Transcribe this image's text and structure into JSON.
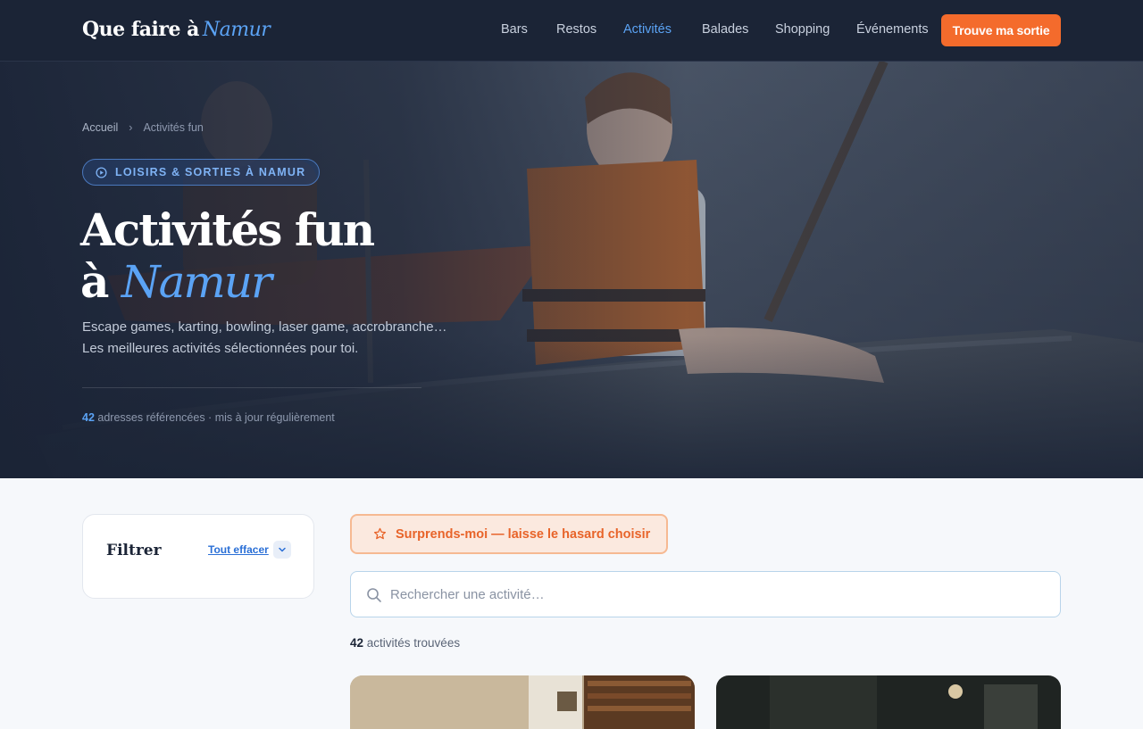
{
  "site": {
    "logo_main": "Que faire à",
    "logo_accent": "Namur"
  },
  "nav": {
    "links": [
      "Bars",
      "Restos",
      "Activités",
      "Balades",
      "Shopping",
      "Événements"
    ],
    "active": "Activités",
    "cta_label": "Trouve ma sortie"
  },
  "hero": {
    "breadcrumb": [
      "Accueil",
      "Activités fun"
    ],
    "badge": "LOISIRS & SORTIES À NAMUR",
    "title_line1": "Activités fun",
    "title_line2_prefix": "à",
    "title_line2_accent": "Namur",
    "subtitle_line1": "Escape games, karting, bowling, laser game, accrobranche…",
    "subtitle_line2": "Les meilleures activités sélectionnées pour toi.",
    "count_number": "42",
    "count_text": " adresses référencées · mis à jour régulièrement"
  },
  "filter": {
    "title": "Filtrer",
    "clear_label": "Tout effacer"
  },
  "surprise": {
    "label": "Surprends-moi — laisse le hasard choisir"
  },
  "search": {
    "placeholder": "Rechercher une activité…"
  },
  "results": {
    "count_number": "42",
    "count_text": " activités trouvées"
  },
  "colors": {
    "nav_bg": "#1b2436",
    "accent_blue": "#5ba3f5",
    "cta_orange": "#f46b2c",
    "page_bg": "#f6f8fb"
  }
}
